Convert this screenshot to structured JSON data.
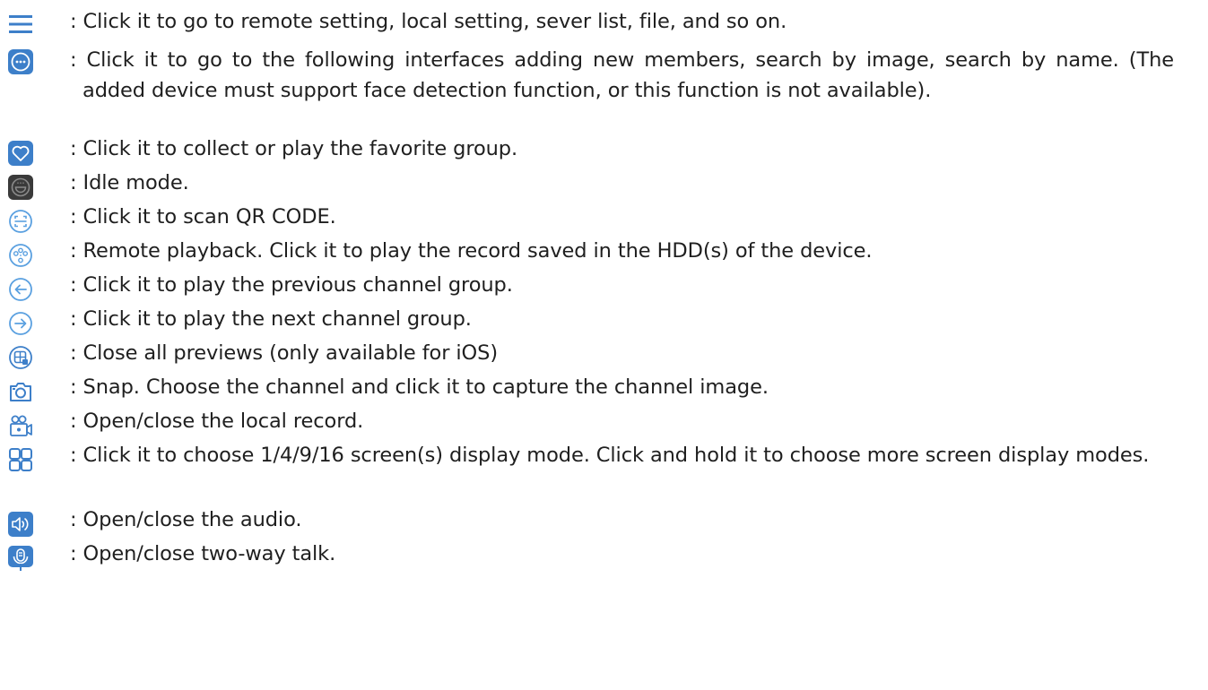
{
  "colors": {
    "icon_blue": "#3d7fc9",
    "icon_light_blue": "#5aa0e0",
    "icon_dark": "#3a3a3a",
    "text": "#1f1f1f"
  },
  "items": [
    {
      "icon": "menu-icon",
      "text": ": Click it to go to remote setting, local setting, sever list, file, and so on."
    },
    {
      "icon": "more-icon",
      "text": ": Click it to go to the following interfaces adding new members, search by image, search by name. (The added device must support face detection function, or this function is not available)."
    },
    {
      "icon": "heart-icon",
      "text": ": Click it to collect or play the favorite group."
    },
    {
      "icon": "idle-mode-icon",
      "text": ": Idle mode."
    },
    {
      "icon": "qr-scan-icon",
      "text": ": Click it to scan QR CODE."
    },
    {
      "icon": "remote-playback-icon",
      "text": ": Remote playback. Click it to play the record saved in the HDD(s) of the device."
    },
    {
      "icon": "previous-icon",
      "text": ": Click it to play the previous channel group."
    },
    {
      "icon": "next-icon",
      "text": ": Click it to play the next channel group."
    },
    {
      "icon": "close-previews-icon",
      "text": ": Close all previews (only available for iOS)"
    },
    {
      "icon": "snap-icon",
      "text": ": Snap. Choose the channel and click it to capture the channel image."
    },
    {
      "icon": "local-record-icon",
      "text": ": Open/close the local record."
    },
    {
      "icon": "screen-mode-icon",
      "text": ": Click it to choose 1/4/9/16 screen(s) display mode. Click and hold it to choose more screen display modes."
    },
    {
      "icon": "audio-icon",
      "text": ": Open/close the audio."
    },
    {
      "icon": "two-way-talk-icon",
      "text": ": Open/close two-way talk."
    }
  ]
}
